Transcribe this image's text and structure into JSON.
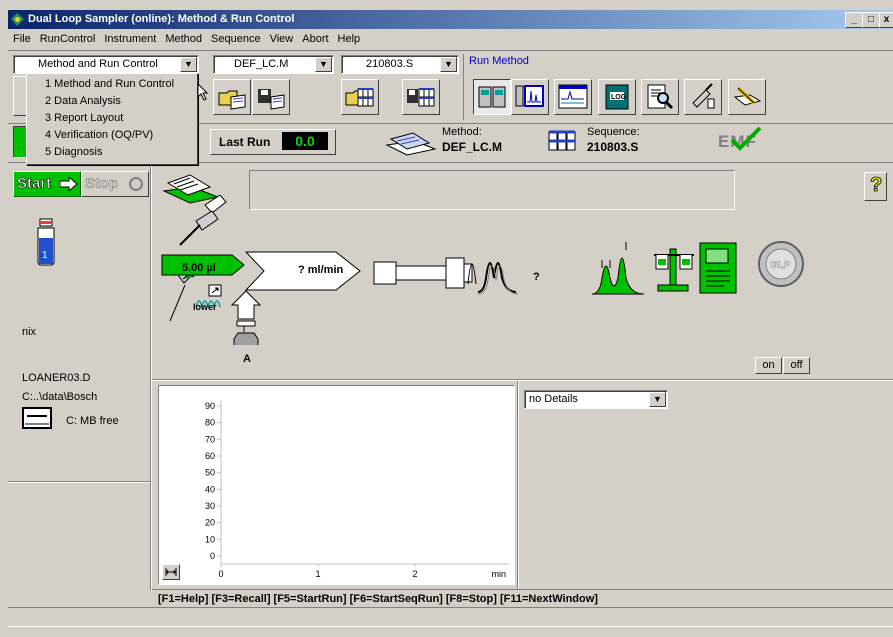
{
  "window": {
    "title": "Dual Loop Sampler (online): Method & Run Control",
    "minimize": "_",
    "maximize": "□",
    "close": "x"
  },
  "menu": [
    "File",
    "RunControl",
    "Instrument",
    "Method",
    "Sequence",
    "View",
    "Abort",
    "Help"
  ],
  "toolbar": {
    "view_select": "Method and Run Control",
    "method_select": "DEF_LC.M",
    "sequence_select": "210803.S",
    "run_method_label": "Run Method"
  },
  "view_menu": {
    "items": [
      "1 Method and Run Control",
      "2 Data Analysis",
      "3 Report Layout",
      "4 Verification (OQ/PV)",
      "5 Diagnosis"
    ]
  },
  "status": {
    "last_run_label": "Last Run",
    "last_run_value": "0.0",
    "method_label": "Method:",
    "method_value": "DEF_LC.M",
    "sequence_label": "Sequence:",
    "sequence_value": "210803.S",
    "emf": "EMF"
  },
  "left": {
    "start": "Start",
    "stop": "Stop",
    "vial_number": "1",
    "sample_name": "nix",
    "datafile": "LOANER03.D",
    "path": "C:..\\data\\Bosch",
    "disk_label": "C:   MB free"
  },
  "schematic": {
    "help": "?",
    "injection_volume": "5.00 µl",
    "flow": "? ml/min",
    "lower": "lower",
    "solvent": "A",
    "peak_unknown": "?",
    "on": "on",
    "off": "off"
  },
  "plot": {
    "yticks": [
      "90",
      "80",
      "70",
      "60",
      "50",
      "40",
      "30",
      "20",
      "10",
      "0"
    ],
    "xticks": [
      "0",
      "1",
      "2"
    ],
    "xunit": "min"
  },
  "details_select": "no Details",
  "status_line": "[F1=Help]  [F3=Recall]  [F5=StartRun]  [F6=StartSeqRun]  [F8=Stop]  [F11=NextWindow]",
  "colors": {
    "title_start": "#0a246a",
    "title_end": "#a6caf0",
    "accent_green": "#00c000",
    "run_method_blue": "#0000c0"
  }
}
